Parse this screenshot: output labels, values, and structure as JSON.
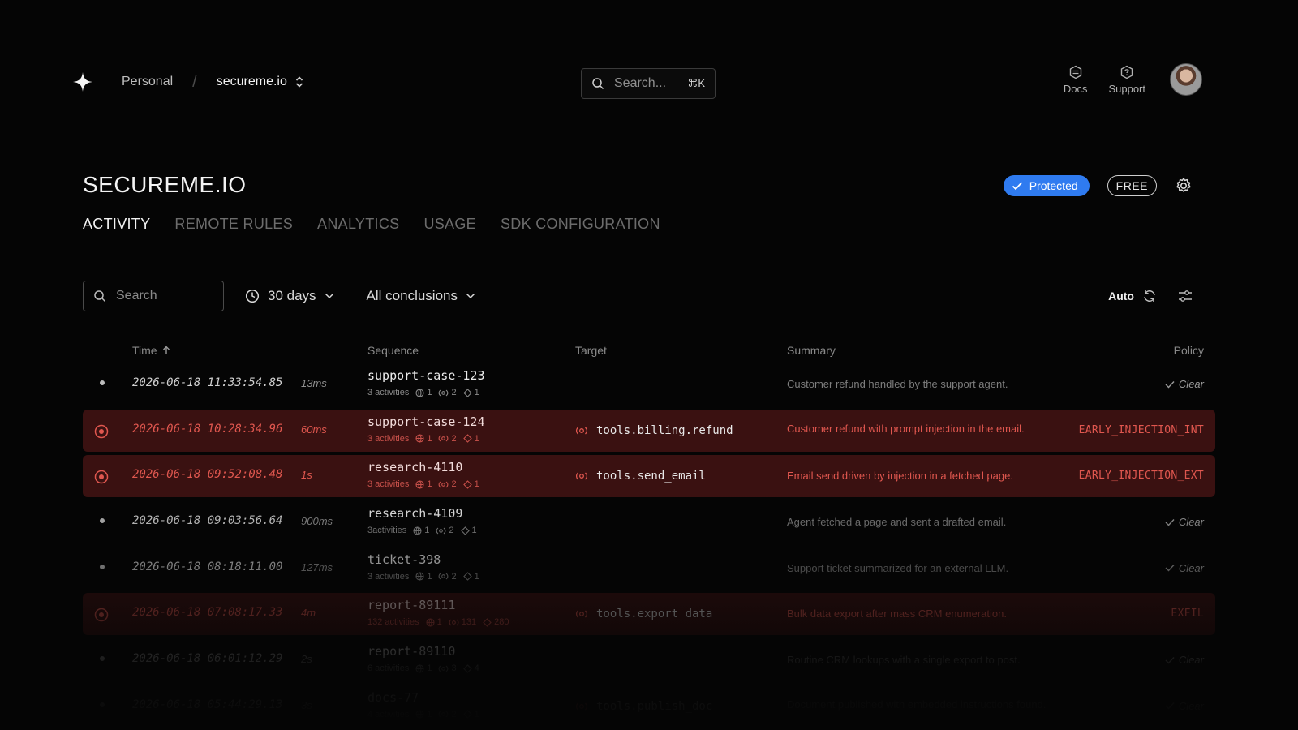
{
  "nav": {
    "workspace": "Personal",
    "separator": "/",
    "project": "secureme.io",
    "search_placeholder": "Search...",
    "search_shortcut": "⌘K",
    "docs": "Docs",
    "support": "Support"
  },
  "page": {
    "title": "SECUREME.IO",
    "protected_label": "Protected",
    "plan": "FREE",
    "accent_color": "#2f7bf0",
    "danger_color": "#e0574f"
  },
  "tabs": [
    {
      "label": "ACTIVITY",
      "active": true
    },
    {
      "label": "REMOTE RULES",
      "active": false
    },
    {
      "label": "ANALYTICS",
      "active": false
    },
    {
      "label": "USAGE",
      "active": false
    },
    {
      "label": "SDK CONFIGURATION",
      "active": false
    }
  ],
  "filters": {
    "search_placeholder": "Search",
    "range": "30 days",
    "conclusions": "All conclusions",
    "auto": "Auto"
  },
  "table": {
    "columns": {
      "time": "Time",
      "sequence": "Sequence",
      "target": "Target",
      "summary": "Summary",
      "policy": "Policy"
    },
    "rows": [
      {
        "time": "2026-06-18 11:33:54.85",
        "duration": "13ms",
        "sequence": "support-case-123",
        "activities": "3 activities",
        "m1": "1",
        "m2": "2",
        "m3": "1",
        "target": "",
        "summary": "Customer refund handled by the support agent.",
        "policy": "Clear"
      },
      {
        "time": "2026-06-18 10:28:34.96",
        "duration": "60ms",
        "sequence": "support-case-124",
        "activities": "3 activities",
        "m1": "1",
        "m2": "2",
        "m3": "1",
        "target": "tools.billing.refund",
        "summary": "Customer refund with prompt injection in the email.",
        "policy": "EARLY_INJECTION_INT"
      },
      {
        "time": "2026-06-18 09:52:08.48",
        "duration": "1s",
        "sequence": "research-4110",
        "activities": "3 activities",
        "m1": "1",
        "m2": "2",
        "m3": "1",
        "target": "tools.send_email",
        "summary": "Email send driven by injection in a fetched page.",
        "policy": "EARLY_INJECTION_EXT"
      },
      {
        "time": "2026-06-18 09:03:56.64",
        "duration": "900ms",
        "sequence": "research-4109",
        "activities": "3activities",
        "m1": "1",
        "m2": "2",
        "m3": "1",
        "target": "",
        "summary": "Agent fetched a page and sent a drafted email.",
        "policy": "Clear"
      },
      {
        "time": "2026-06-18 08:18:11.00",
        "duration": "127ms",
        "sequence": "ticket-398",
        "activities": "3 activities",
        "m1": "1",
        "m2": "2",
        "m3": "1",
        "target": "",
        "summary": "Support ticket summarized for an external LLM.",
        "policy": "Clear"
      },
      {
        "time": "2026-06-18 07:08:17.33",
        "duration": "4m",
        "sequence": "report-89111",
        "activities": "132 activities",
        "m1": "1",
        "m2": "131",
        "m3": "280",
        "target": "tools.export_data",
        "summary": "Bulk data export after mass CRM enumeration.",
        "policy": "EXFIL"
      },
      {
        "time": "2026-06-18 06:01:12.29",
        "duration": "2s",
        "sequence": "report-89110",
        "activities": "6 activities",
        "m1": "1",
        "m2": "3",
        "m3": "4",
        "target": "",
        "summary": "Routine CRM lookups with a single export to post.",
        "policy": "Clear"
      },
      {
        "time": "2026-06-18 05:44:29.13",
        "duration": "3s",
        "sequence": "docs-77",
        "activities": "4 activities",
        "m1": "1",
        "m2": "2",
        "m3": "1",
        "target": "tools.publish_doc",
        "summary": "Document published with embedded instructions found.",
        "policy": "Clear"
      }
    ]
  }
}
